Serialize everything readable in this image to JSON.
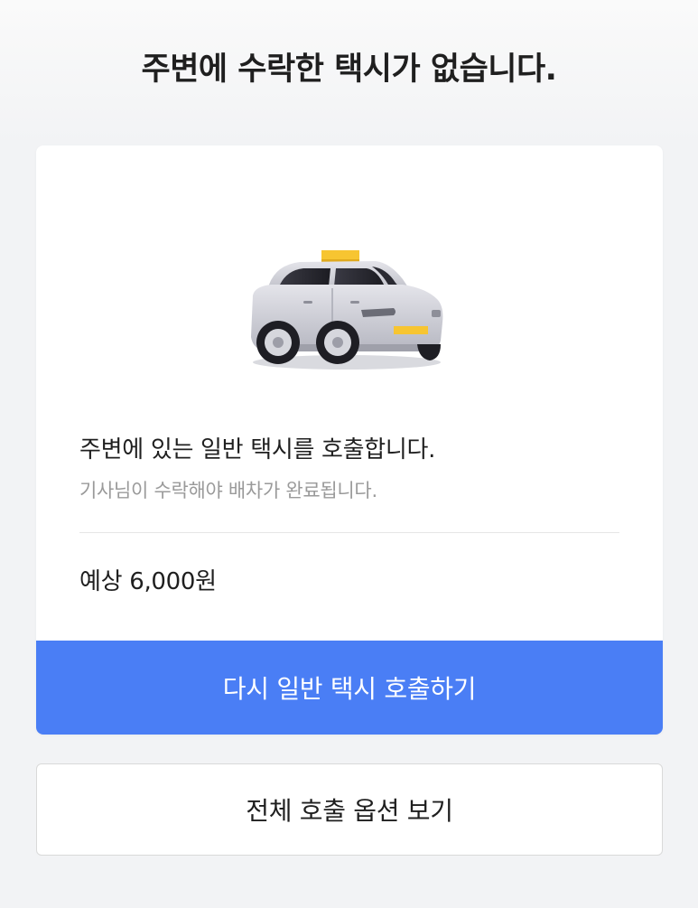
{
  "header": {
    "title": "주변에 수락한 택시가 없습니다."
  },
  "card": {
    "illustration_icon": "taxi-icon",
    "description": "주변에 있는 일반 택시를 호출합니다.",
    "subdescription": "기사님이 수락해야 배차가 완료됩니다.",
    "fare_label": "예상 6,000원",
    "retry_label": "다시 일반 택시 호출하기"
  },
  "options": {
    "label": "전체 호출 옵션 보기"
  },
  "colors": {
    "accent": "#4a7ef5",
    "taxi_sign": "#f7c531",
    "background": "#f2f3f5"
  }
}
